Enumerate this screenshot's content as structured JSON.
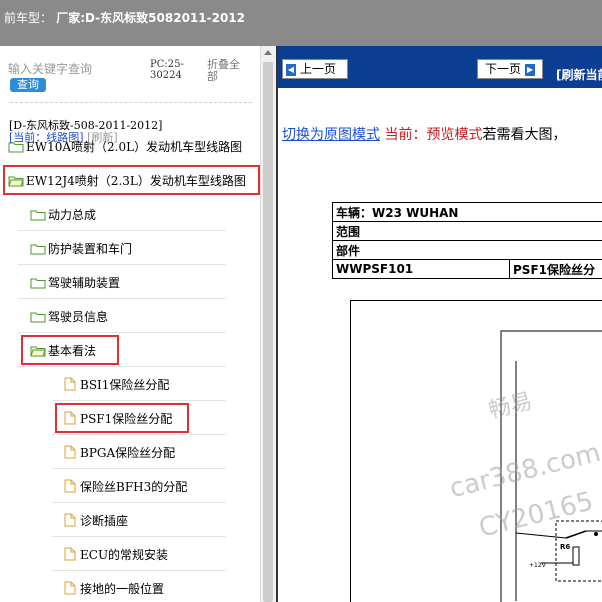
{
  "header": {
    "label": "前车型：",
    "value": "厂家:D-东风标致5082011-2012"
  },
  "sidebar": {
    "search_placeholder": "输入关键字查询",
    "search_button": "查询",
    "pc_label": "PC:25-30224",
    "collapse_label": "折叠全部",
    "path_label": "[D-东风标致-508-2011-2012]",
    "current_label": "[当前：线路图]",
    "refresh_label": "[刷新]",
    "items": [
      {
        "label": "EW10A喷射（2.0L）发动机车型线路图",
        "type": "folder"
      },
      {
        "label": "EW12J4喷射（2.3L）发动机车型线路图",
        "type": "folder-open"
      },
      {
        "label": "动力总成",
        "type": "folder"
      },
      {
        "label": "防护装置和车门",
        "type": "folder"
      },
      {
        "label": "驾驶辅助装置",
        "type": "folder"
      },
      {
        "label": "驾驶员信息",
        "type": "folder"
      },
      {
        "label": "基本看法",
        "type": "folder-open"
      },
      {
        "label": "BSI1保险丝分配",
        "type": "page"
      },
      {
        "label": "PSF1保险丝分配",
        "type": "page"
      },
      {
        "label": "BPGA保险丝分配",
        "type": "page"
      },
      {
        "label": "保险丝BFH3的分配",
        "type": "page"
      },
      {
        "label": "诊断插座",
        "type": "page"
      },
      {
        "label": "ECU的常规安装",
        "type": "page"
      },
      {
        "label": "接地的一般位置",
        "type": "page"
      }
    ]
  },
  "viewer": {
    "prev_button": "上一页",
    "next_button": "下一页",
    "refresh_current": "[刷新当前",
    "switch_link": "切换为原图模式",
    "current_mode": "当前：预览模式",
    "hint": "若需看大图，",
    "table": {
      "vehicle": "车辆：W23 WUHAN",
      "scope": "范围",
      "part": "部件",
      "code": "WWPSF101",
      "desc": "PSF1保险丝分"
    },
    "watermark": [
      "畅易",
      "car388.com",
      "CY20165"
    ],
    "diagram_labels": {
      "relay": "R6",
      "voltage": "+12V"
    }
  },
  "colors": {
    "highlight": "#e03030",
    "navbar": "#0b3d91",
    "link": "#1a4fd6"
  }
}
